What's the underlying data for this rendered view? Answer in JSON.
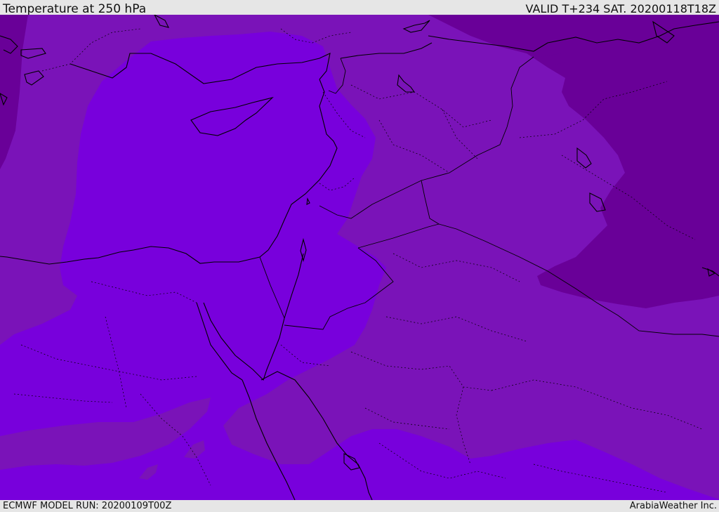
{
  "header": {
    "title": "Temperature at 250 hPa",
    "valid": "VALID T+234 SAT. 20200118T18Z"
  },
  "footer": {
    "model_run": "ECMWF MODEL RUN: 20200109T00Z",
    "credit": "ArabiaWeather Inc."
  },
  "map": {
    "colors": {
      "bright_band": "#7800dc",
      "mid_band": "#7a13b8",
      "dark_band": "#690098",
      "coast": "#000000"
    }
  }
}
